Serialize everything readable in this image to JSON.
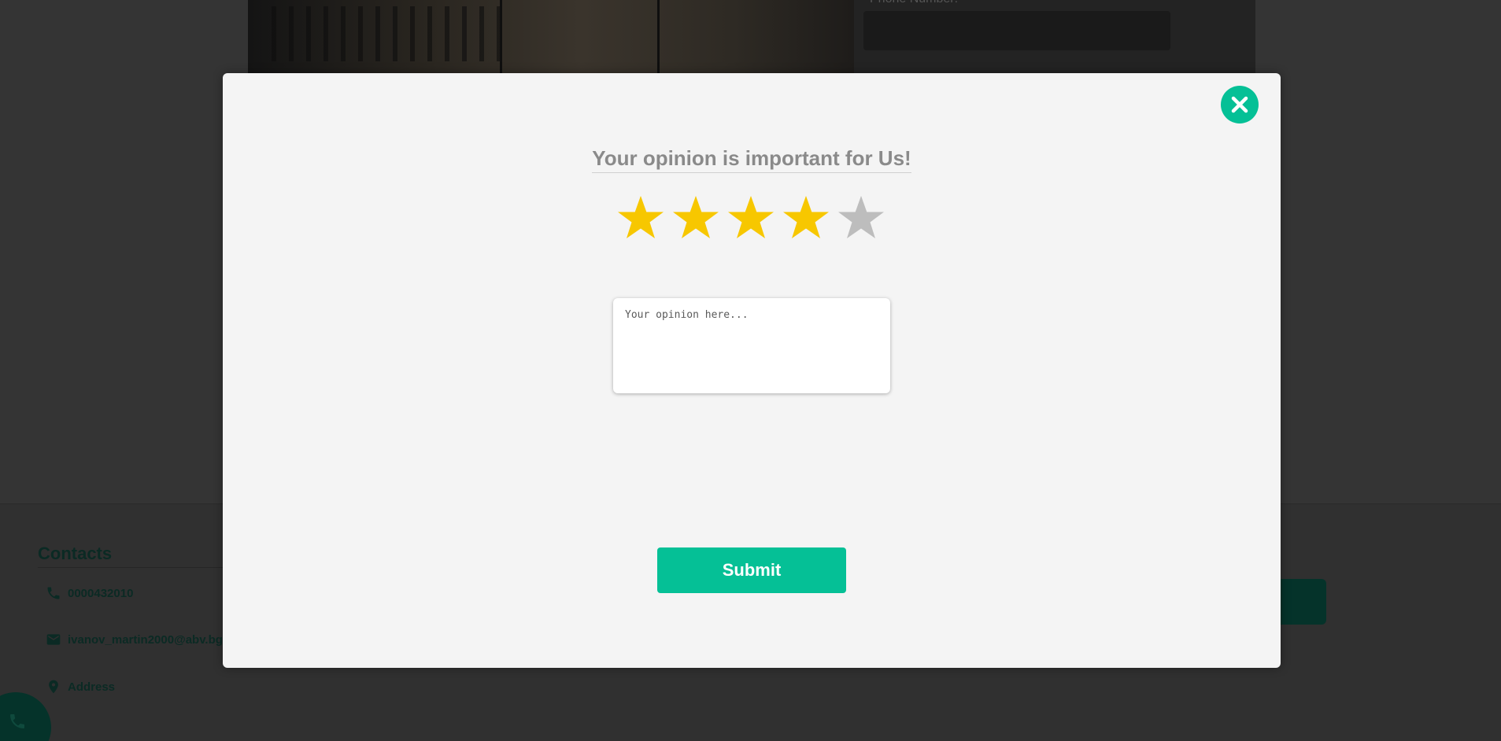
{
  "background": {
    "form_label": "Phone Number:",
    "contacts": {
      "title": "Contacts",
      "phone": "0000432010",
      "email": "ivanov_martin2000@abv.bg",
      "address": "Address"
    }
  },
  "modal": {
    "title": "Your opinion is important for Us!",
    "rating": {
      "value": 4,
      "max": 5
    },
    "opinion_placeholder": "Your opinion here...",
    "submit_label": "Submit"
  },
  "colors": {
    "accent": "#05c096",
    "star_filled": "#f7c700",
    "star_empty": "#bdbdbd",
    "modal_bg": "#f4f4f4"
  },
  "icons": {
    "close": "close-icon",
    "star": "star-icon",
    "phone": "phone-icon",
    "email": "email-icon",
    "location": "location-pin-icon"
  }
}
